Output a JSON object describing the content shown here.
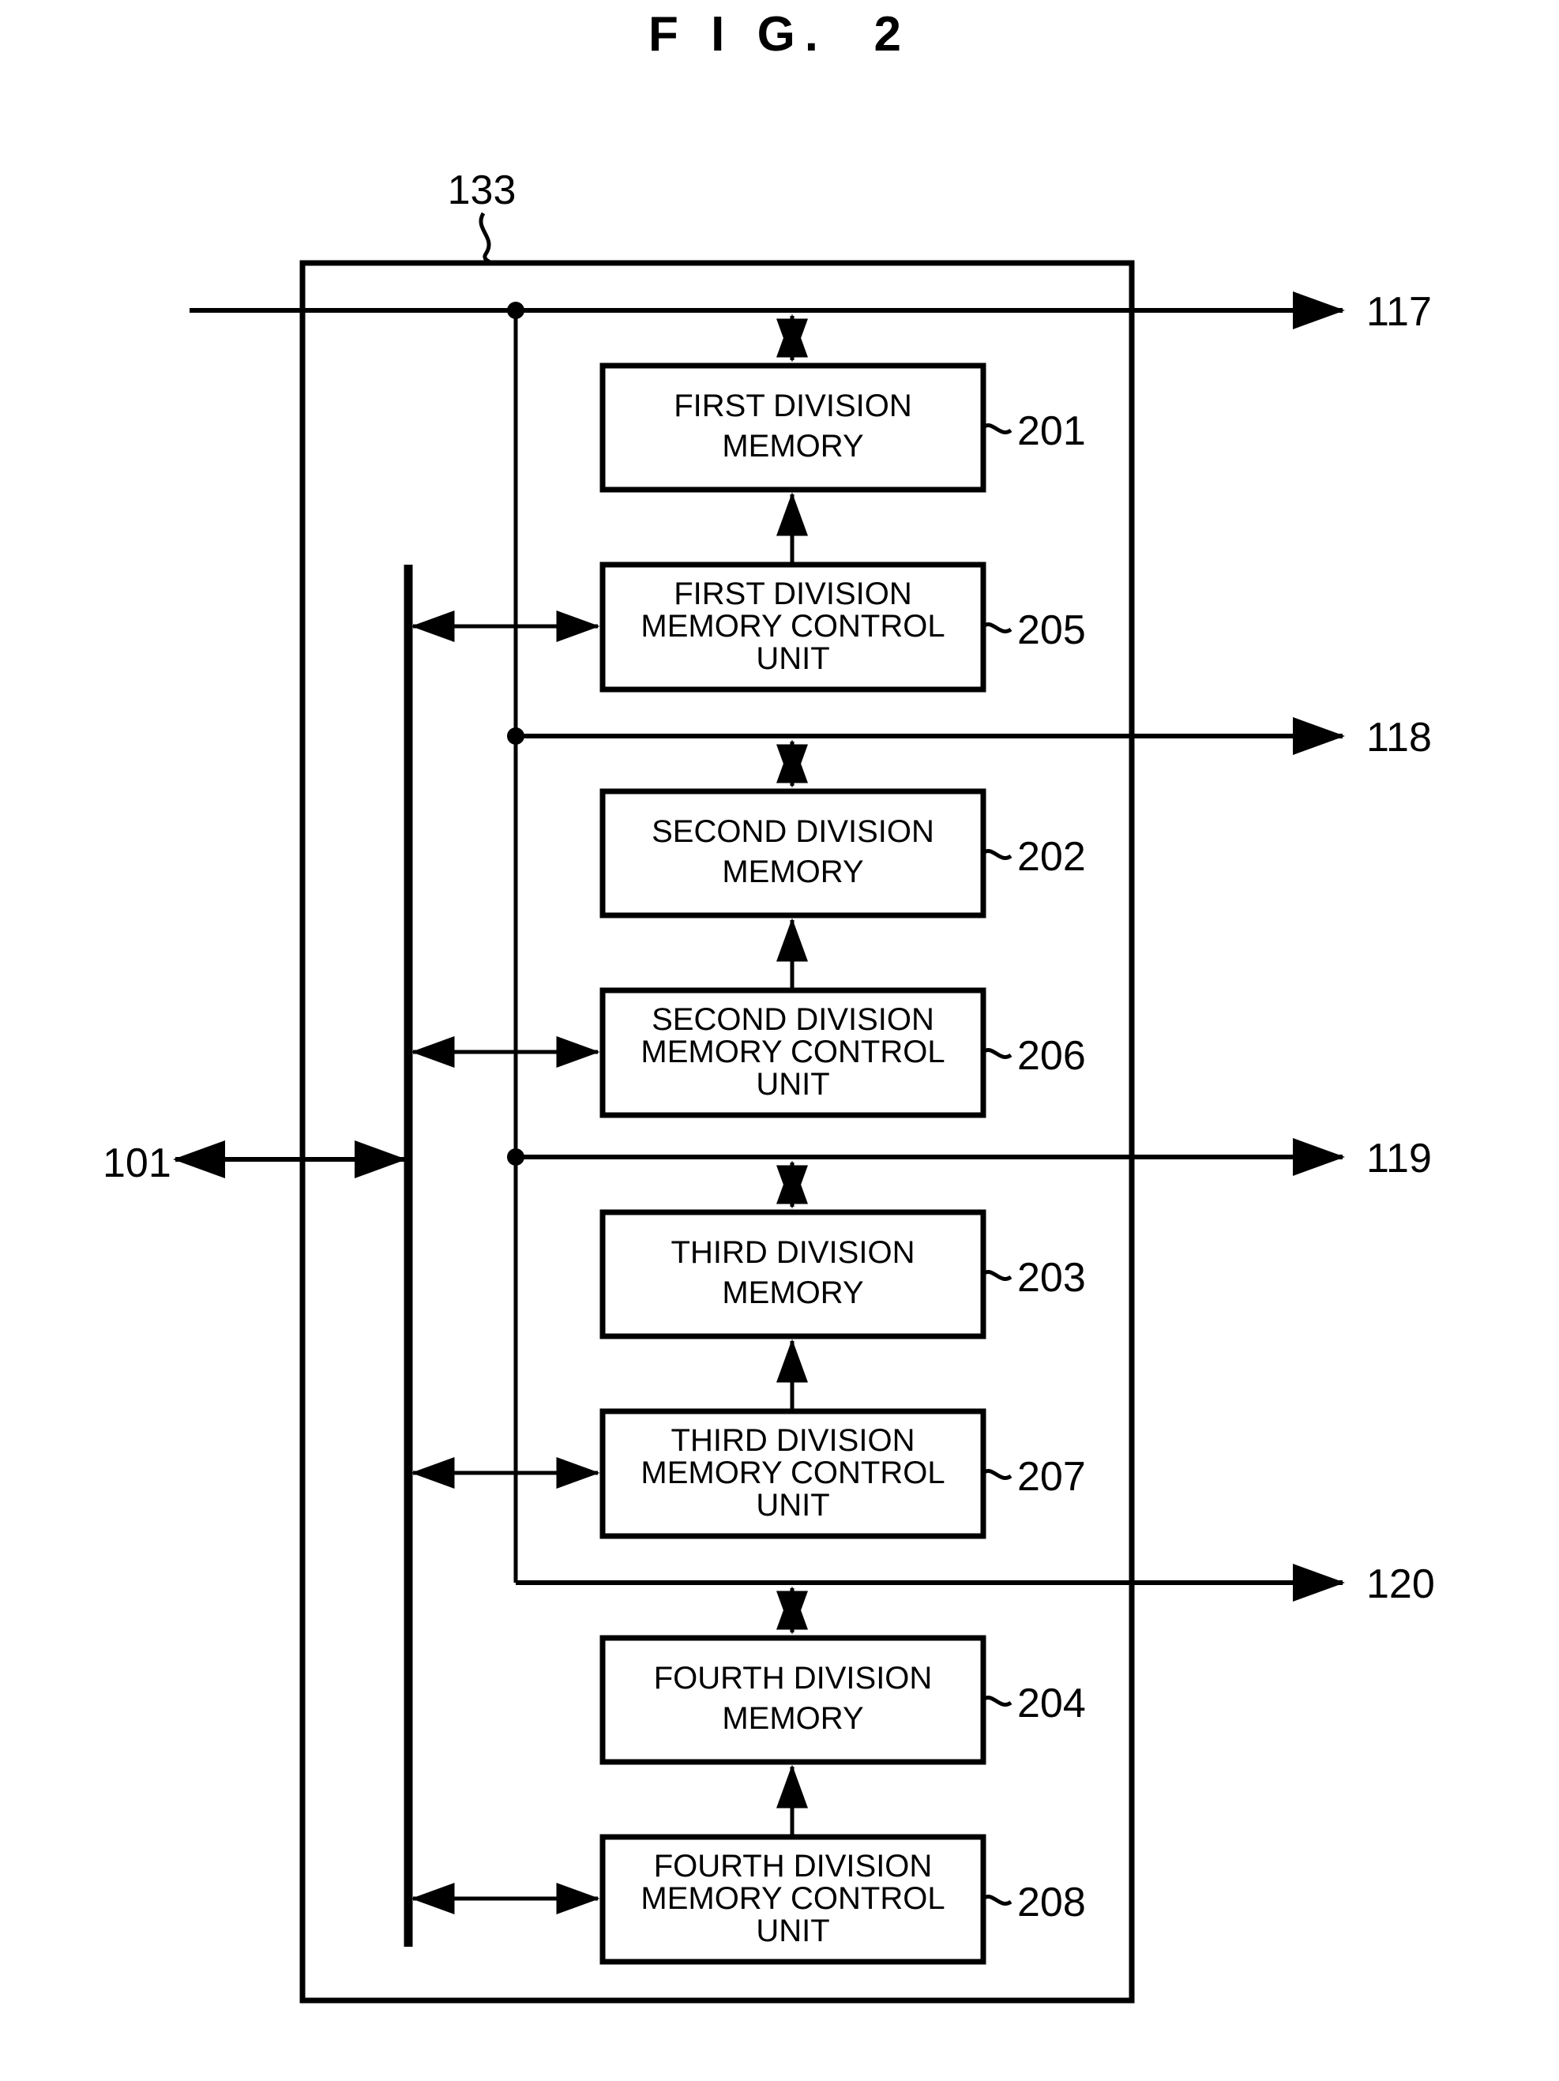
{
  "figure": {
    "title": "F I G.  2",
    "outer_label": "133"
  },
  "ports": [
    {
      "id": "p117",
      "label": "117"
    },
    {
      "id": "p118",
      "label": "118"
    },
    {
      "id": "p119",
      "label": "119"
    },
    {
      "id": "p120",
      "label": "120"
    }
  ],
  "external_bus": {
    "label": "101"
  },
  "blocks": [
    {
      "id": "mem1",
      "ref": "201",
      "lines": [
        "FIRST DIVISION",
        "MEMORY"
      ],
      "kind": "memory"
    },
    {
      "id": "ctl1",
      "ref": "205",
      "lines": [
        "FIRST DIVISION",
        "MEMORY CONTROL",
        "UNIT"
      ],
      "kind": "control"
    },
    {
      "id": "mem2",
      "ref": "202",
      "lines": [
        "SECOND DIVISION",
        "MEMORY"
      ],
      "kind": "memory"
    },
    {
      "id": "ctl2",
      "ref": "206",
      "lines": [
        "SECOND DIVISION",
        "MEMORY CONTROL",
        "UNIT"
      ],
      "kind": "control"
    },
    {
      "id": "mem3",
      "ref": "203",
      "lines": [
        "THIRD DIVISION",
        "MEMORY"
      ],
      "kind": "memory"
    },
    {
      "id": "ctl3",
      "ref": "207",
      "lines": [
        "THIRD DIVISION",
        "MEMORY CONTROL",
        "UNIT"
      ],
      "kind": "control"
    },
    {
      "id": "mem4",
      "ref": "204",
      "lines": [
        "FOURTH DIVISION",
        "MEMORY"
      ],
      "kind": "memory"
    },
    {
      "id": "ctl4",
      "ref": "208",
      "lines": [
        "FOURTH DIVISION",
        "MEMORY CONTROL",
        "UNIT"
      ],
      "kind": "control"
    }
  ],
  "colors": {
    "ink": "#000000",
    "paper": "#ffffff"
  }
}
